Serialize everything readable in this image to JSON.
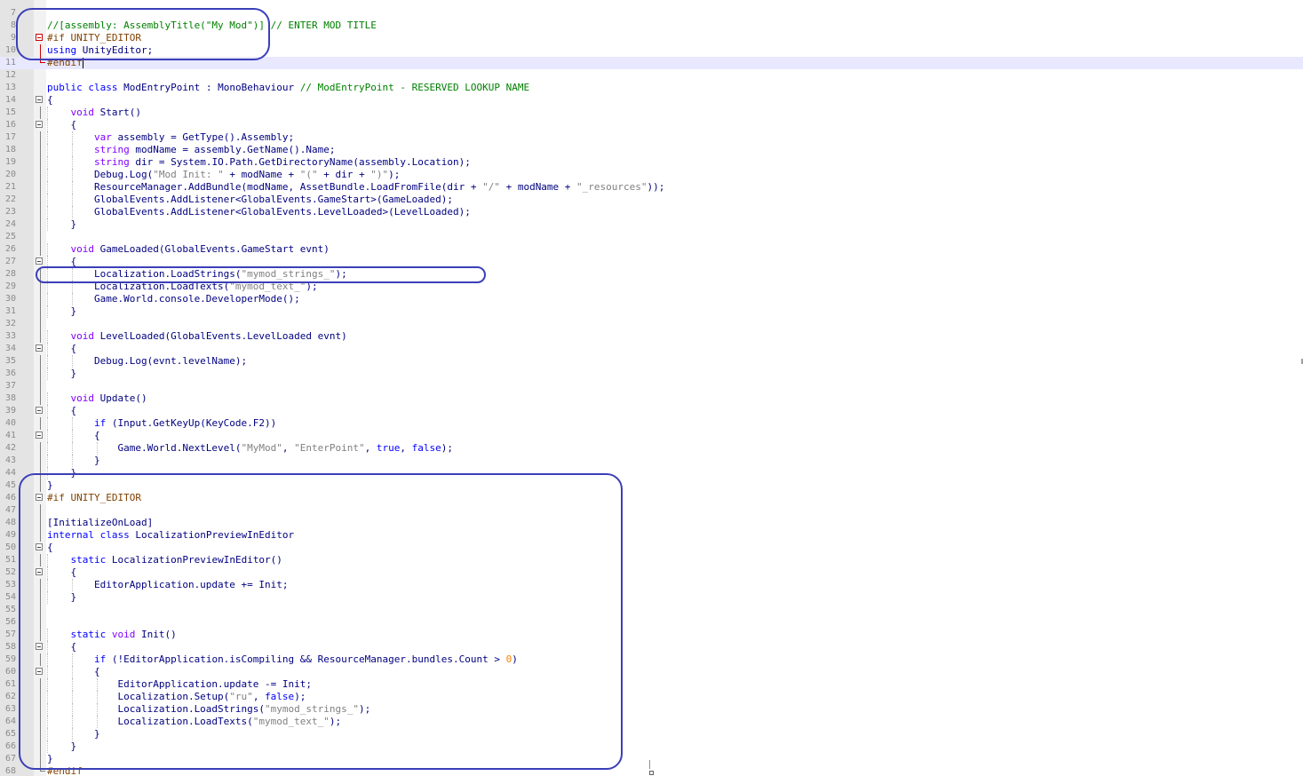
{
  "editor": {
    "current_line": 11,
    "lines": [
      {
        "n": 7,
        "html": ""
      },
      {
        "n": 8,
        "html": "<span class=\"cmt\">//[assembly: AssemblyTitle(\"My Mod\")] // ENTER MOD TITLE</span>"
      },
      {
        "n": 9,
        "html": "<span class=\"pre\">#if UNITY_EDITOR</span>"
      },
      {
        "n": 10,
        "html": "<span class=\"kw\">using</span> UnityEditor;"
      },
      {
        "n": 11,
        "html": "<span class=\"pre\">#endif</span>",
        "cursor": true
      },
      {
        "n": 12,
        "html": ""
      },
      {
        "n": 13,
        "html": "<span class=\"kw\">public</span> <span class=\"kw\">class</span> ModEntryPoint : MonoBehaviour <span class=\"cmt\">// ModEntryPoint - RESERVED LOOKUP NAME</span>"
      },
      {
        "n": 14,
        "html": "{"
      },
      {
        "n": 15,
        "html": "    <span class=\"type\">void</span> Start()"
      },
      {
        "n": 16,
        "html": "    {"
      },
      {
        "n": 17,
        "html": "        <span class=\"type\">var</span> assembly = GetType().Assembly;"
      },
      {
        "n": 18,
        "html": "        <span class=\"type\">string</span> modName = assembly.GetName().Name;"
      },
      {
        "n": 19,
        "html": "        <span class=\"type\">string</span> dir = System.IO.Path.GetDirectoryName(assembly.Location);"
      },
      {
        "n": 20,
        "html": "        Debug.Log(<span class=\"str\">\"Mod Init: \"</span> + modName + <span class=\"str\">\"(\"</span> + dir + <span class=\"str\">\")\"</span>);"
      },
      {
        "n": 21,
        "html": "        ResourceManager.AddBundle(modName, AssetBundle.LoadFromFile(dir + <span class=\"str\">\"/\"</span> + modName + <span class=\"str\">\"_resources\"</span>));"
      },
      {
        "n": 22,
        "html": "        GlobalEvents.AddListener&lt;GlobalEvents.GameStart&gt;(GameLoaded);"
      },
      {
        "n": 23,
        "html": "        GlobalEvents.AddListener&lt;GlobalEvents.LevelLoaded&gt;(LevelLoaded);"
      },
      {
        "n": 24,
        "html": "    }"
      },
      {
        "n": 25,
        "html": ""
      },
      {
        "n": 26,
        "html": "    <span class=\"type\">void</span> GameLoaded(GlobalEvents.GameStart evnt)"
      },
      {
        "n": 27,
        "html": "    {"
      },
      {
        "n": 28,
        "html": "        Localization.LoadStrings(<span class=\"str\">\"mymod_strings_\"</span>);"
      },
      {
        "n": 29,
        "html": "        Localization.LoadTexts(<span class=\"str\">\"mymod_text_\"</span>);"
      },
      {
        "n": 30,
        "html": "        Game.World.console.DeveloperMode();"
      },
      {
        "n": 31,
        "html": "    }"
      },
      {
        "n": 32,
        "html": ""
      },
      {
        "n": 33,
        "html": "    <span class=\"type\">void</span> LevelLoaded(GlobalEvents.LevelLoaded evnt)"
      },
      {
        "n": 34,
        "html": "    {"
      },
      {
        "n": 35,
        "html": "        Debug.Log(evnt.levelName);"
      },
      {
        "n": 36,
        "html": "    }"
      },
      {
        "n": 37,
        "html": ""
      },
      {
        "n": 38,
        "html": "    <span class=\"type\">void</span> Update()"
      },
      {
        "n": 39,
        "html": "    {"
      },
      {
        "n": 40,
        "html": "        <span class=\"kw\">if</span> (Input.GetKeyUp(KeyCode.F2))"
      },
      {
        "n": 41,
        "html": "        {"
      },
      {
        "n": 42,
        "html": "            Game.World.NextLevel(<span class=\"str\">\"MyMod\"</span>, <span class=\"str\">\"EnterPoint\"</span>, <span class=\"kw\">true</span>, <span class=\"kw\">false</span>);"
      },
      {
        "n": 43,
        "html": "        }"
      },
      {
        "n": 44,
        "html": "    }"
      },
      {
        "n": 45,
        "html": "}"
      },
      {
        "n": 46,
        "html": "<span class=\"pre\">#if UNITY_EDITOR</span>"
      },
      {
        "n": 47,
        "html": ""
      },
      {
        "n": 48,
        "html": "[InitializeOnLoad]"
      },
      {
        "n": 49,
        "html": "<span class=\"kw\">internal</span> <span class=\"kw\">class</span> LocalizationPreviewInEditor"
      },
      {
        "n": 50,
        "html": "{"
      },
      {
        "n": 51,
        "html": "    <span class=\"kw\">static</span> LocalizationPreviewInEditor()"
      },
      {
        "n": 52,
        "html": "    {"
      },
      {
        "n": 53,
        "html": "        EditorApplication.update += Init;"
      },
      {
        "n": 54,
        "html": "    }"
      },
      {
        "n": 55,
        "html": ""
      },
      {
        "n": 56,
        "html": ""
      },
      {
        "n": 57,
        "html": "    <span class=\"kw\">static</span> <span class=\"type\">void</span> Init()"
      },
      {
        "n": 58,
        "html": "    {"
      },
      {
        "n": 59,
        "html": "        <span class=\"kw\">if</span> (!EditorApplication.isCompiling &amp;&amp; ResourceManager.bundles.Count &gt; <span class=\"num\">0</span>)"
      },
      {
        "n": 60,
        "html": "        {"
      },
      {
        "n": 61,
        "html": "            EditorApplication.update -= Init;"
      },
      {
        "n": 62,
        "html": "            Localization.Setup(<span class=\"str\">\"ru\"</span>, <span class=\"kw\">false</span>);"
      },
      {
        "n": 63,
        "html": "            Localization.LoadStrings(<span class=\"str\">\"mymod_strings_\"</span>);"
      },
      {
        "n": 64,
        "html": "            Localization.LoadTexts(<span class=\"str\">\"mymod_text_\"</span>);"
      },
      {
        "n": 65,
        "html": "        }"
      },
      {
        "n": 66,
        "html": "    }"
      },
      {
        "n": 67,
        "html": "}"
      },
      {
        "n": 68,
        "html": "<span class=\"pre\">#endif</span>"
      }
    ]
  }
}
